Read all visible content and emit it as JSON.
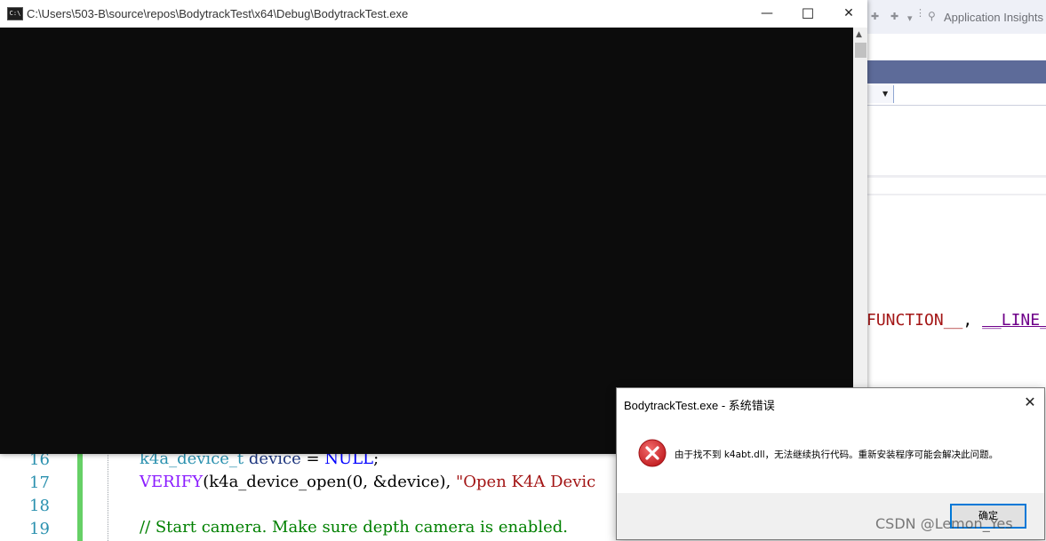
{
  "background_ide": {
    "toolbar": {
      "application_insights_label": "Application Insights"
    },
    "code_fragment": {
      "part1": "FUNCTION__",
      "comma1": ",",
      "part2": "__LINE__"
    },
    "editor_lines": [
      {
        "number": "16",
        "indent": "    ",
        "type": "k4a_device_t",
        "space": " ",
        "var": "device",
        "rest": " = ",
        "null": "NULL",
        "end": ";"
      },
      {
        "number": "17",
        "verify": "VERIFY",
        "open": "(k4a_device_open(0, &device), ",
        "str": "\"Open K4A Devic"
      },
      {
        "number": "18"
      },
      {
        "number": "19",
        "comment": "// Start camera. Make sure depth camera is enabled."
      }
    ]
  },
  "console": {
    "title": "C:\\Users\\503-B\\source\\repos\\BodytrackTest\\x64\\Debug\\BodytrackTest.exe",
    "icon_label": "C:\\",
    "minimize_glyph": "—",
    "maximize_glyph": "☐",
    "close_glyph": "✕"
  },
  "dialog": {
    "title": "BodytrackTest.exe - 系统错误",
    "close_glyph": "✕",
    "message": "由于找不到 k4abt.dll，无法继续执行代码。重新安装程序可能会解决此问题。",
    "ok_label": "确定"
  },
  "watermark": "CSDN @Lemon_Yes",
  "colors": {
    "console_bg": "#0c0c0c",
    "error_red": "#d9262a",
    "focus_blue": "#0078d7",
    "vs_tab_blue": "#5d6b99"
  }
}
